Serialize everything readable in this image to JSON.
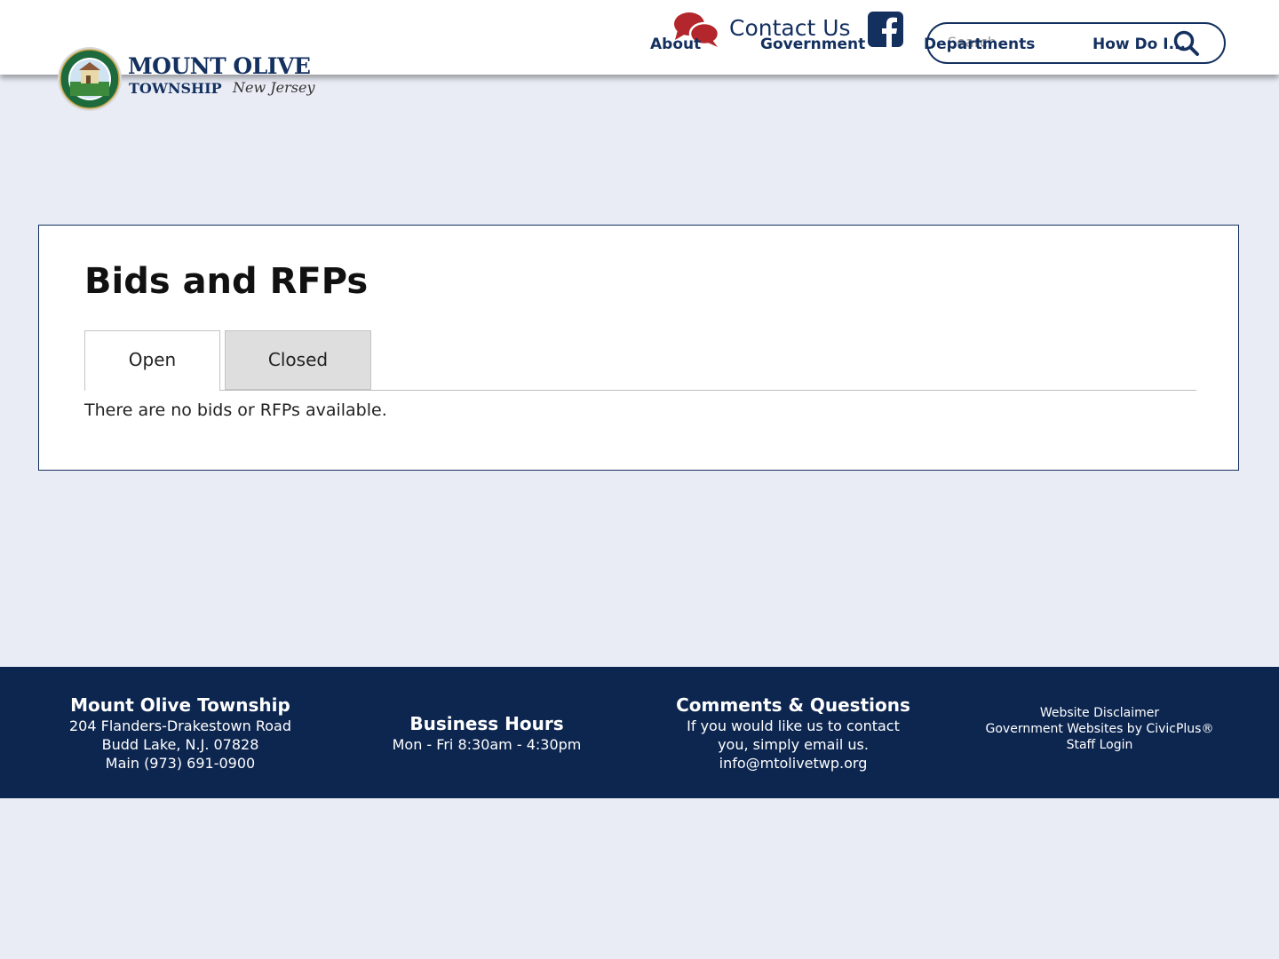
{
  "header": {
    "logo": {
      "line1": "MOUNT OLIVE",
      "line2": "TOWNSHIP",
      "script": "New Jersey",
      "seal_text": "MOUNT OLIVE TOWNSHIP"
    },
    "contact_us": "Contact Us",
    "search_placeholder": "Search",
    "nav": [
      {
        "label": "About"
      },
      {
        "label": "Government"
      },
      {
        "label": "Departments"
      },
      {
        "label": "How Do I..."
      }
    ]
  },
  "main": {
    "title": "Bids and RFPs",
    "tabs": [
      {
        "label": "Open",
        "active": true
      },
      {
        "label": "Closed",
        "active": false
      }
    ],
    "empty_message": "There are no bids or RFPs available."
  },
  "footer": {
    "col1": {
      "heading": "Mount Olive Township",
      "lines": [
        "204 Flanders-Drakestown Road",
        "Budd Lake, N.J. 07828",
        "Main (973) 691-0900"
      ]
    },
    "col2": {
      "heading": "Business Hours",
      "lines": [
        "Mon - Fri 8:30am - 4:30pm"
      ]
    },
    "col3": {
      "heading": "Comments & Questions",
      "lines": [
        "If you would like us to contact",
        "you, simply email us.",
        "info@mtolivetwp.org"
      ]
    },
    "links": [
      "Website Disclaimer",
      "Government Websites by CivicPlus®",
      "Staff Login"
    ]
  },
  "colors": {
    "navy": "#14305f",
    "footer_bg": "#0d2650",
    "page_bg": "#e9ecf5",
    "contact_icon_red": "#b3262b",
    "tab_inactive_bg": "#dedede"
  },
  "icons": [
    "chat-bubbles-icon",
    "facebook-icon",
    "search-icon",
    "township-seal-icon"
  ]
}
